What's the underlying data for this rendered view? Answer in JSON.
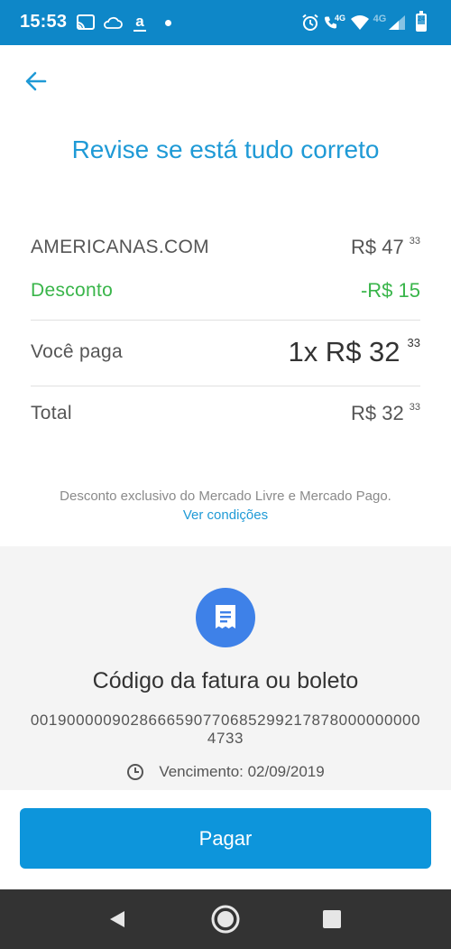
{
  "status_bar": {
    "time": "15:53",
    "left_icons": [
      "cast-icon",
      "cloud-icon",
      "amazon-icon",
      "dot-icon"
    ],
    "amazon_glyph": "a",
    "right_icons": [
      "alarm-icon",
      "call-4g-icon",
      "wifi-icon",
      "signal-4g-icon",
      "battery-icon"
    ],
    "network_label": "4G",
    "signal_label": "4G",
    "battery_level": "24",
    "bg_color": "#0e87c8"
  },
  "header": {
    "title": "Revise se está tudo correto"
  },
  "summary": {
    "merchant": {
      "label": "AMERICANAS.COM",
      "currency_amount": "R$ 47",
      "cents": "33"
    },
    "discount": {
      "label": "Desconto",
      "amount": "-R$ 15"
    },
    "you_pay": {
      "label": "Você paga",
      "amount": "1x R$ 32",
      "cents": "33"
    },
    "total": {
      "label": "Total",
      "amount": "R$ 32",
      "cents": "33"
    }
  },
  "disclaimer": {
    "text": "Desconto exclusivo do Mercado Livre e Mercado Pago.",
    "link": "Ver condições"
  },
  "bill": {
    "title": "Código da fatura ou boleto",
    "code": "00190000090286665907706852992178780000000004733",
    "due_label": "Vencimento: 02/09/2019"
  },
  "actions": {
    "pay_label": "Pagar"
  },
  "colors": {
    "accent": "#1f9ad6",
    "discount_green": "#39b54a",
    "button": "#0d95db",
    "bill_icon": "#3e81e8"
  }
}
